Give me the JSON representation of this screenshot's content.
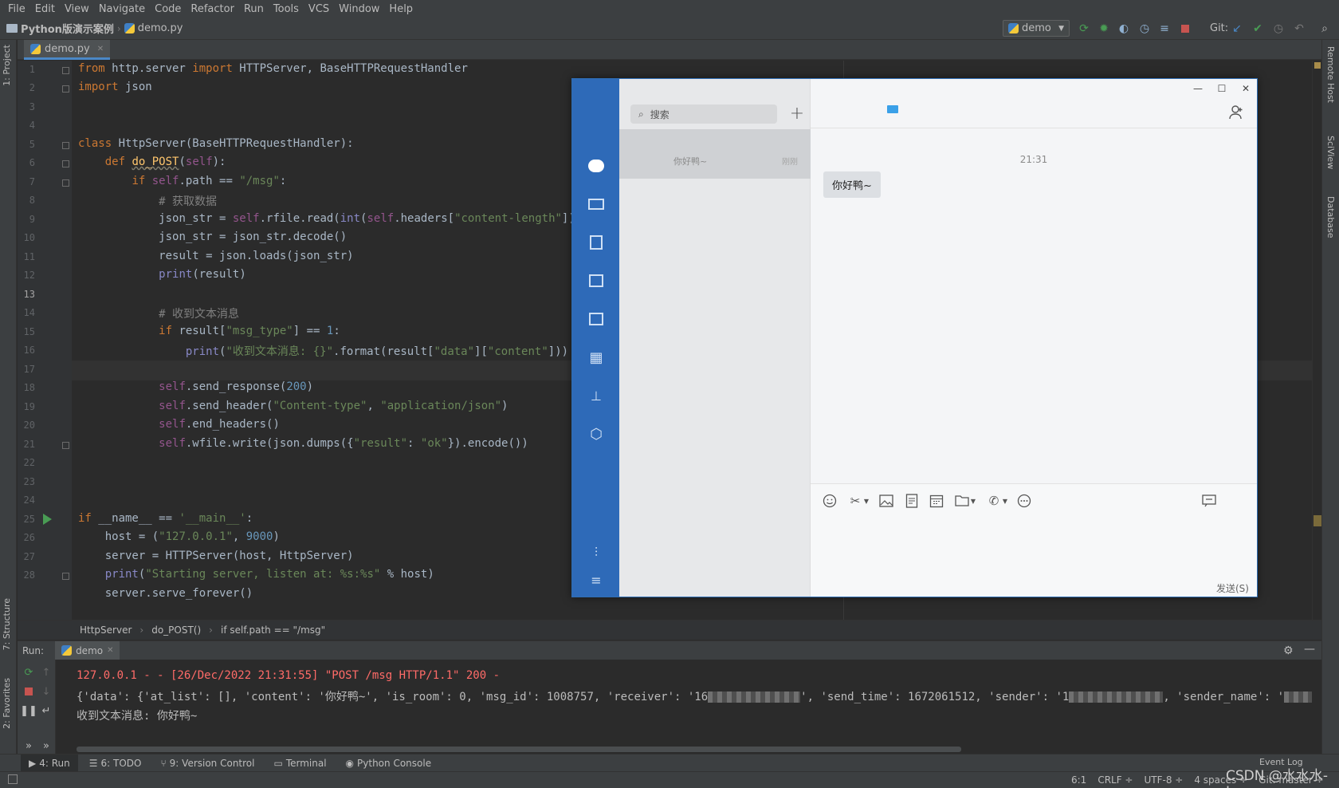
{
  "menu": [
    "File",
    "Edit",
    "View",
    "Navigate",
    "Code",
    "Refactor",
    "Run",
    "Tools",
    "VCS",
    "Window",
    "Help"
  ],
  "breadcrumbs": {
    "project": "Python版演示案例",
    "file": "demo.py"
  },
  "run_config": "demo",
  "git_label": "Git:",
  "editor_tab": "demo.py",
  "left_tabs": {
    "project": "1: Project",
    "structure": "7: Structure",
    "favorites": "2: Favorites"
  },
  "right_tabs": {
    "remote": "Remote Host",
    "sciview": "SciView",
    "database": "Database"
  },
  "line_numbers": [
    "1",
    "2",
    "3",
    "4",
    "5",
    "6",
    "7",
    "8",
    "9",
    "10",
    "11",
    "12",
    "13",
    "14",
    "15",
    "16",
    "17",
    "18",
    "19",
    "20",
    "21",
    "22",
    "23",
    "24",
    "25",
    "26",
    "27",
    "28"
  ],
  "code": {
    "l1_a": "from",
    "l1_b": " http.server ",
    "l1_c": "import",
    "l1_d": " HTTPServer, BaseHTTPRequestHandler",
    "l2_a": "import",
    "l2_b": " json",
    "l5_a": "class",
    "l5_b": " HttpServer(BaseHTTPRequestHandler):",
    "l6_a": "def",
    "l6_b": "do_POST",
    "l6_c": "(",
    "l6_d": "self",
    "l6_e": "):",
    "l7_a": "if",
    "l7_b": "self",
    "l7_c": ".path == ",
    "l7_d": "\"/msg\"",
    "l7_e": ":",
    "l8": "# 获取数据",
    "l9_a": "json_str = ",
    "l9_b": "self",
    "l9_c": ".rfile.read(",
    "l9_d": "int",
    "l9_e": "(",
    "l9_f": "self",
    "l9_g": ".headers[",
    "l9_h": "\"content-length\"",
    "l9_i": "]))",
    "l10": "json_str = json_str.decode()",
    "l11": "result = json.loads(json_str)",
    "l12_a": "print",
    "l12_b": "(result)",
    "l14": "# 收到文本消息",
    "l15_a": "if",
    "l15_b": " result[",
    "l15_c": "\"msg_type\"",
    "l15_d": "] == ",
    "l15_e": "1",
    "l15_f": ":",
    "l16_a": "print",
    "l16_b": "(",
    "l16_c": "\"收到文本消息: {}\"",
    "l16_d": ".format(result[",
    "l16_e": "\"data\"",
    "l16_f": "][",
    "l16_g": "\"content\"",
    "l16_h": "]))",
    "l18_a": "self",
    "l18_b": ".send_response(",
    "l18_c": "200",
    "l18_d": ")",
    "l19_a": "self",
    "l19_b": ".send_header(",
    "l19_c": "\"Content-type\"",
    "l19_d": ", ",
    "l19_e": "\"application/json\"",
    "l19_f": ")",
    "l20_a": "self",
    "l20_b": ".end_headers()",
    "l21_a": "self",
    "l21_b": ".wfile.write(json.dumps({",
    "l21_c": "\"result\"",
    "l21_d": ": ",
    "l21_e": "\"ok\"",
    "l21_f": "}).encode())",
    "l24_a": "if",
    "l24_b": " __name__ == ",
    "l24_c": "'__main__'",
    "l24_d": ":",
    "l25_a": "host = (",
    "l25_b": "\"127.0.0.1\"",
    "l25_c": ", ",
    "l25_d": "9000",
    "l25_e": ")",
    "l26": "server = HTTPServer(host, HttpServer)",
    "l27_a": "print",
    "l27_b": "(",
    "l27_c": "\"Starting server, listen at: %s:%s\"",
    "l27_d": " % host)",
    "l28": "server.serve_forever()"
  },
  "editor_footer": [
    "HttpServer",
    "do_POST()",
    "if self.path == \"/msg\""
  ],
  "run_panel": {
    "label": "Run:",
    "tab": "demo"
  },
  "console": {
    "line1": "127.0.0.1 - - [26/Dec/2022 21:31:55] \"POST /msg HTTP/1.1\" 200 -",
    "line2_a": "{'data': {'at_list': [], 'content': '你好鸭~', 'is_room': 0, 'msg_id': 1008757, 'receiver': '16",
    "line2_b": "', 'send_time': 1672061512, 'sender': '1",
    "line2_c": ", 'sender_name': '",
    "line2_d": "'},",
    "line3": "收到文本消息: 你好鸭~"
  },
  "bottom_tabs": [
    {
      "label": "4: Run"
    },
    {
      "label": "6: TODO"
    },
    {
      "label": "9: Version Control"
    },
    {
      "label": "Terminal"
    },
    {
      "label": "Python Console"
    }
  ],
  "event_log": "Event Log",
  "status": {
    "position": "6:1",
    "line_ending": "CRLF ÷",
    "encoding": "UTF-8 ÷",
    "indent": "4 spaces ÷",
    "branch": "Git: master ÷"
  },
  "watermark": "CSDN @水水水-Jun",
  "chat": {
    "search_placeholder": "搜索",
    "add_icon": "+",
    "conversation_preview": "你好鸭~",
    "conversation_time": "刚刚",
    "message_time": "21:31",
    "message_text": "你好鸭~",
    "send_label": "发送(S)"
  },
  "colors": {
    "ide_bg": "#2b2b2b",
    "chat_nav": "#2e6ab8",
    "run_green": "#499c54",
    "console_red": "#ff6b68"
  }
}
